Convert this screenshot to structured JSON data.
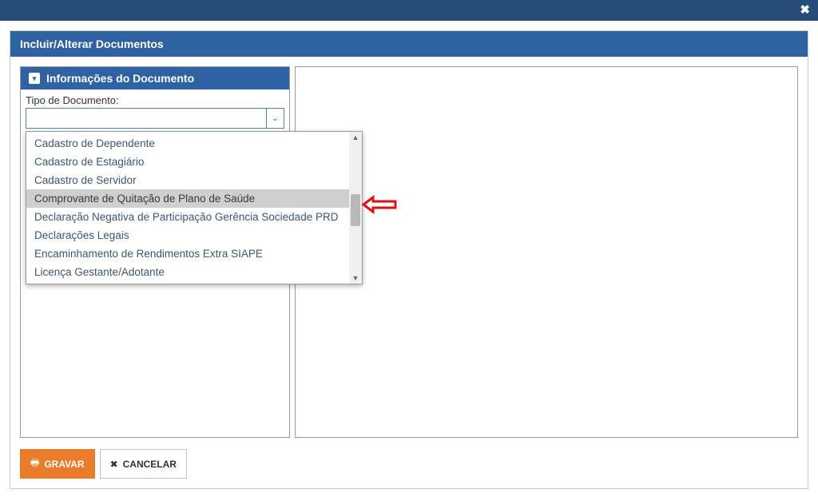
{
  "topbar": {
    "close": "✖"
  },
  "modal": {
    "title": "Incluir/Alterar Documentos",
    "section": {
      "caret": "▾",
      "title": "Informações do Documento",
      "field_label": "Tipo de Documento:",
      "select_value": "",
      "select_arrow": "⌄"
    }
  },
  "dropdown": {
    "options": [
      {
        "label": "Cadastro de Dependente",
        "selected": false
      },
      {
        "label": "Cadastro de Estagiário",
        "selected": false
      },
      {
        "label": "Cadastro de Servidor",
        "selected": false
      },
      {
        "label": "Comprovante de Quitação de Plano de Saúde",
        "selected": true
      },
      {
        "label": "Declaração Negativa de Participação Gerência Sociedade PRD",
        "selected": false
      },
      {
        "label": "Declarações Legais",
        "selected": false
      },
      {
        "label": "Encaminhamento de Rendimentos Extra SIAPE",
        "selected": false
      },
      {
        "label": "Licença Gestante/Adotante",
        "selected": false
      }
    ],
    "scroll_up": "▲",
    "scroll_down": "▼"
  },
  "buttons": {
    "save_icon": "🖶",
    "save_label": "GRAVAR",
    "cancel_icon": "✖",
    "cancel_label": "CANCELAR"
  },
  "colors": {
    "blue_header": "#2f62a3",
    "blue_dark": "#274c78",
    "orange": "#ea7b28",
    "teal_border": "#4a8d8f",
    "option_text": "#3e5670",
    "selected_bg": "#cfcfcf",
    "arrow_red": "#e11010"
  }
}
